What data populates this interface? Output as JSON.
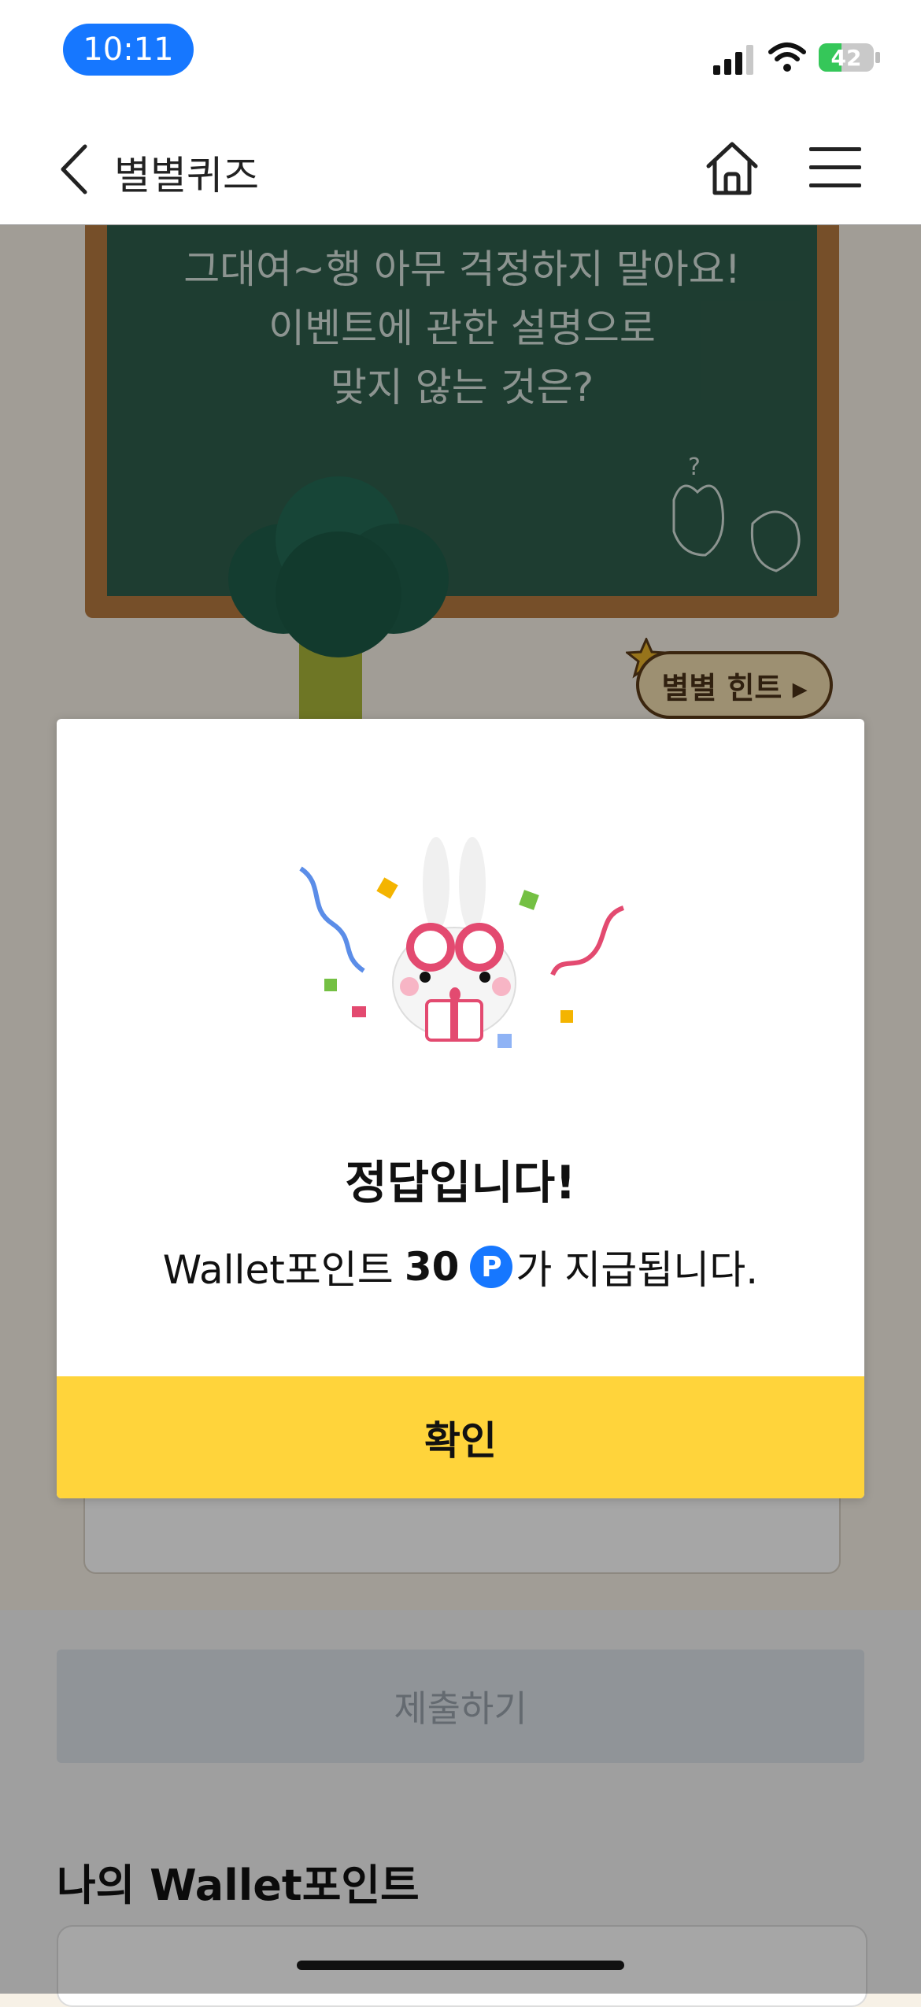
{
  "status_bar": {
    "time": "10:11",
    "battery_percent": "42",
    "battery_level": 0.42
  },
  "nav": {
    "title": "별별퀴즈"
  },
  "quiz": {
    "question_lines": [
      "그대여~행 아무 걱정하지 말아요!",
      "이벤트에 관한 설명으로",
      "맞지 않는 것은?"
    ],
    "hint_label": "별별 힌트 ▸"
  },
  "modal": {
    "title": "정답입니다!",
    "message_prefix": "Wallet포인트",
    "message_amount": "30",
    "points_icon": "P",
    "message_suffix": "가 지급됩니다.",
    "confirm_label": "확인"
  },
  "submit": {
    "label": "제출하기"
  },
  "wallet": {
    "section_title": "나의 Wallet포인트"
  },
  "colors": {
    "accent_blue": "#1677ff",
    "confirm_yellow": "#ffd43b",
    "board_green": "#2f5e4c",
    "board_frame": "#b57a3f"
  }
}
